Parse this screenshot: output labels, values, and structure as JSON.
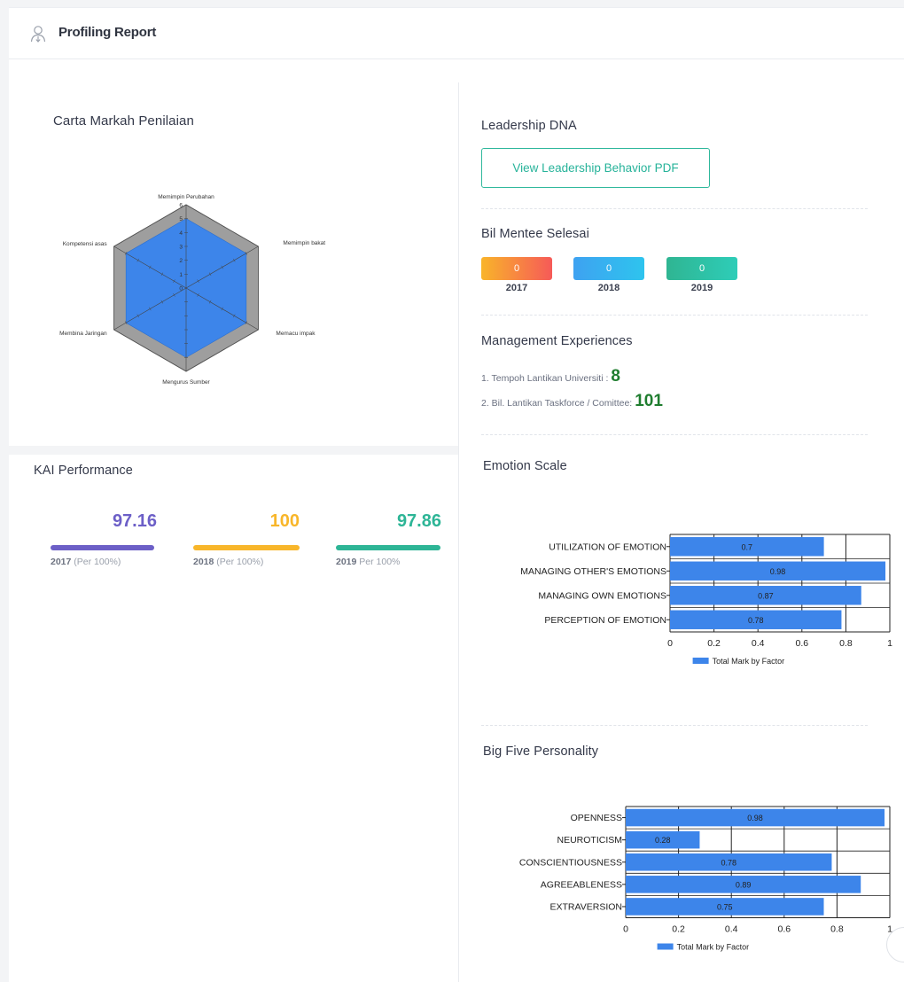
{
  "header": {
    "title": "Profiling Report",
    "icon": "user-icon"
  },
  "radar": {
    "title": "Carta Markah Penilaian",
    "chart_data": {
      "type": "radar",
      "axes": [
        "Memimpin Perubahan",
        "Memimpin bakat",
        "Memacu impak",
        "Mengurus Sumber",
        "Membina Jaringan",
        "Kompetensi asas"
      ],
      "tick_labels": [
        "0",
        "1",
        "2",
        "3",
        "4",
        "5",
        "6"
      ],
      "range": [
        0,
        6
      ],
      "series": [
        {
          "values": [
            5.0,
            5.0,
            5.0,
            5.0,
            5.0,
            5.0
          ],
          "color": "#3d85ea"
        },
        {
          "values": [
            6,
            6,
            6,
            6,
            6,
            6
          ],
          "color": "#9e9e9e"
        }
      ]
    }
  },
  "leadership": {
    "title": "Leadership DNA",
    "button_label": "View Leadership Behavior PDF"
  },
  "mentee": {
    "title": "Bil Mentee Selesai",
    "items": [
      {
        "value": "0",
        "year": "2017"
      },
      {
        "value": "0",
        "year": "2018"
      },
      {
        "value": "0",
        "year": "2019"
      }
    ]
  },
  "management": {
    "title": "Management Experiences",
    "lines": [
      {
        "label": "1. Tempoh Lantikan Universiti :",
        "value": "8"
      },
      {
        "label": "2. Bil. Lantikan Taskforce / Comittee:",
        "value": "101"
      }
    ]
  },
  "kai": {
    "title": "KAI Performance",
    "items": [
      {
        "value": "97.16",
        "year": "2017",
        "suffix": "(Per 100%)",
        "color": "#6c5fc7"
      },
      {
        "value": "100",
        "year": "2018",
        "suffix": "(Per 100%)",
        "color": "#f8b62a"
      },
      {
        "value": "97.86",
        "year": "2019",
        "suffix": "Per 100%",
        "color": "#2db596"
      }
    ]
  },
  "emotion": {
    "title": "Emotion Scale",
    "chart_data": {
      "type": "bar",
      "orientation": "horizontal",
      "categories": [
        "UTILIZATION OF EMOTION",
        "MANAGING OTHER'S EMOTIONS",
        "MANAGING OWN EMOTIONS",
        "PERCEPTION OF EMOTION"
      ],
      "values": [
        0.7,
        0.98,
        0.87,
        0.78
      ],
      "xlim": [
        0,
        1
      ],
      "xticks": [
        "0",
        "0.2",
        "0.4",
        "0.6",
        "0.8",
        "1"
      ],
      "legend": "Total Mark by Factor",
      "color": "#3d85ea"
    }
  },
  "bigfive": {
    "title": "Big Five Personality",
    "chart_data": {
      "type": "bar",
      "orientation": "horizontal",
      "categories": [
        "OPENNESS",
        "NEUROTICISM",
        "CONSCIENTIOUSNESS",
        "AGREEABLENESS",
        "EXTRAVERSION"
      ],
      "values": [
        0.98,
        0.28,
        0.78,
        0.89,
        0.75
      ],
      "xlim": [
        0,
        1
      ],
      "xticks": [
        "0",
        "0.2",
        "0.4",
        "0.6",
        "0.8",
        "1"
      ],
      "legend": "Total Mark by Factor",
      "color": "#3d85ea"
    }
  }
}
